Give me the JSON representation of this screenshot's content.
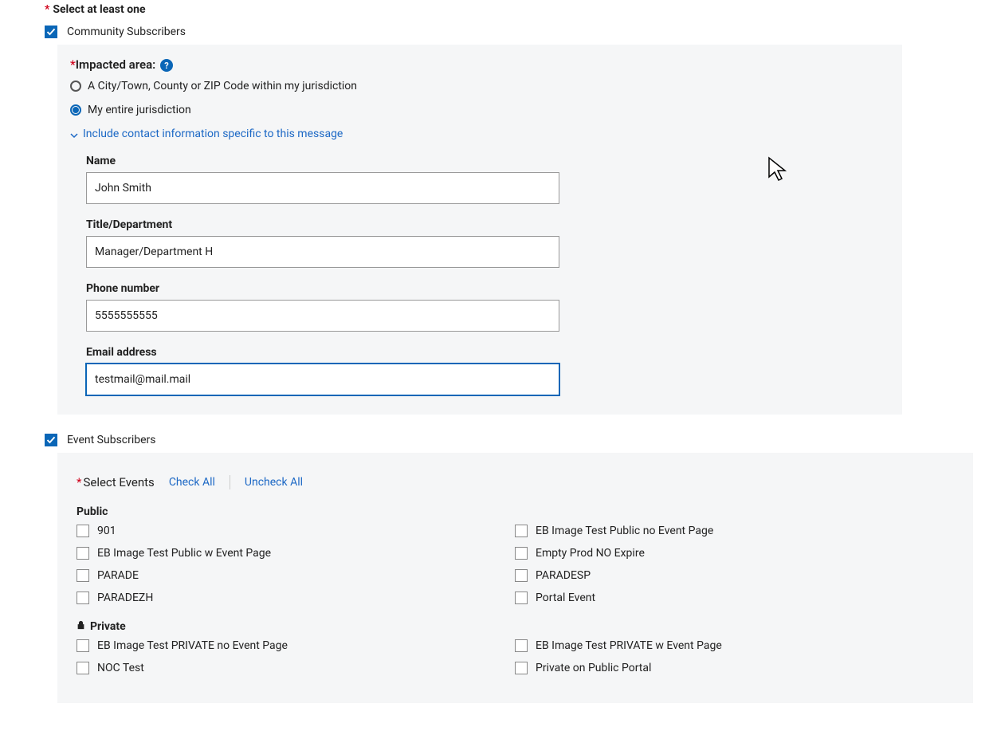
{
  "header": {
    "select_at_least_one": "Select at least one"
  },
  "community": {
    "label": "Community Subscribers",
    "impacted_area_label": "Impacted area:",
    "radio_city": "A City/Town, County or ZIP Code within my jurisdiction",
    "radio_entire": "My entire jurisdiction",
    "expand_text": "Include contact information specific to this message",
    "fields": {
      "name_label": "Name",
      "name_value": "John Smith",
      "title_label": "Title/Department",
      "title_value": "Manager/Department H",
      "phone_label": "Phone number",
      "phone_value": "5555555555",
      "email_label": "Email address",
      "email_value": "testmail@mail.mail"
    }
  },
  "events": {
    "label": "Event Subscribers",
    "select_events": "Select Events",
    "check_all": "Check All",
    "uncheck_all": "Uncheck All",
    "public_heading": "Public",
    "private_heading": "Private",
    "public_items": {
      "i0": "901",
      "i1": "EB Image Test Public no Event Page",
      "i2": "EB Image Test Public w Event Page",
      "i3": "Empty Prod NO Expire",
      "i4": "PARADE",
      "i5": "PARADESP",
      "i6": "PARADEZH",
      "i7": "Portal Event"
    },
    "private_items": {
      "i0": "EB Image Test PRIVATE no Event Page",
      "i1": "EB Image Test PRIVATE w Event Page",
      "i2": "NOC Test",
      "i3": "Private on Public Portal"
    }
  }
}
